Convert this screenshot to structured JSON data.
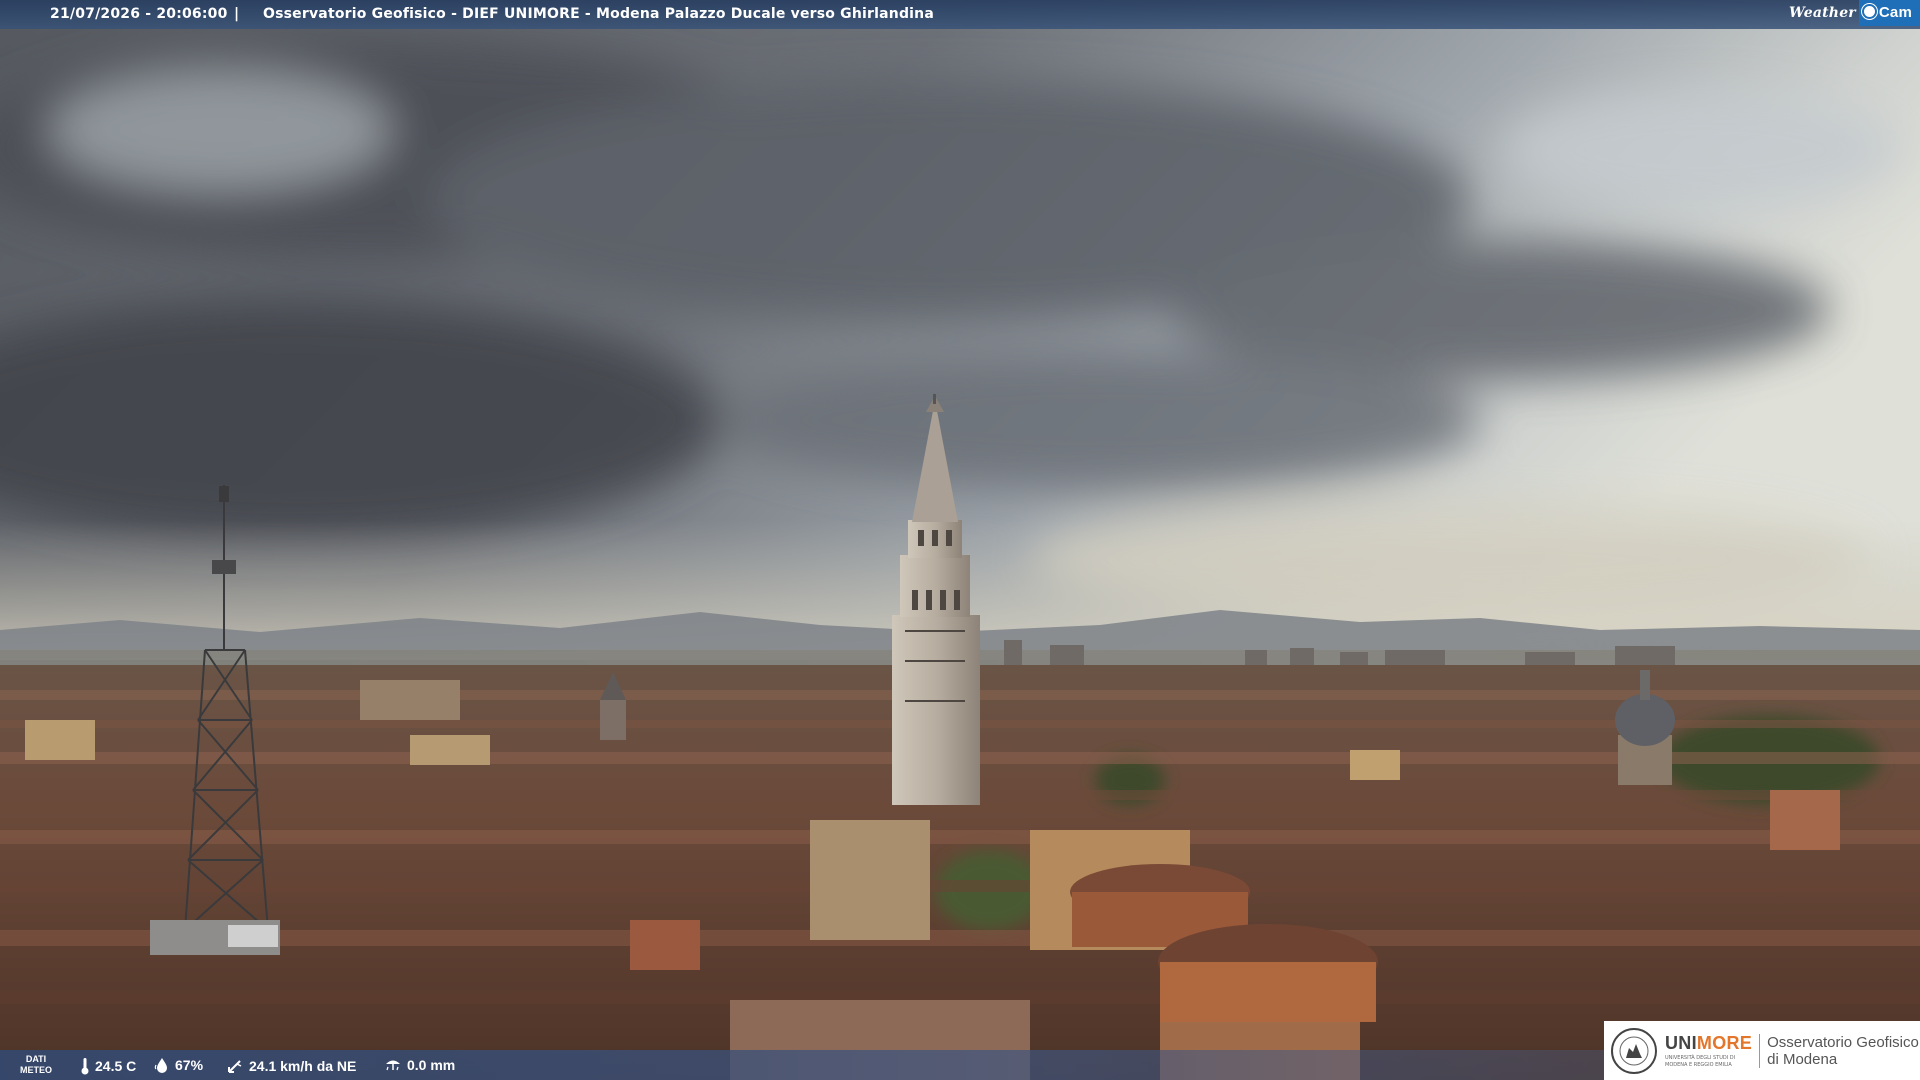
{
  "header": {
    "timestamp": "21/07/2026 - 20:06:00",
    "separator": "|",
    "title": "Osservatorio Geofisico - DIEF UNIMORE - Modena Palazzo Ducale verso Ghirlandina",
    "brand_word": "Weather",
    "brand_box": "Cam"
  },
  "weather": {
    "label_line1": "DATI",
    "label_line2": "METEO",
    "temperature": "24.5 C",
    "humidity": "67%",
    "wind": "24.1 km/h da NE",
    "rain": "0.0 mm"
  },
  "logo": {
    "uni_part1": "UNI",
    "uni_part2": "MORE",
    "uni_sub1": "UNIVERSITÀ DEGLI STUDI DI",
    "uni_sub2": "MODENA E REGGIO EMILIA",
    "obs_line1": "Osservatorio Geofisico",
    "obs_line2": "di Modena"
  },
  "colors": {
    "bar": "#34486e",
    "brand_blue": "#1e6fb7",
    "unimore_orange": "#e3762b"
  },
  "icons": {
    "temperature": "thermometer-icon",
    "humidity": "drop-icon",
    "wind": "wind-arrow-icon",
    "rain": "rain-gauge-icon",
    "logo": "unimore-seal-icon"
  }
}
